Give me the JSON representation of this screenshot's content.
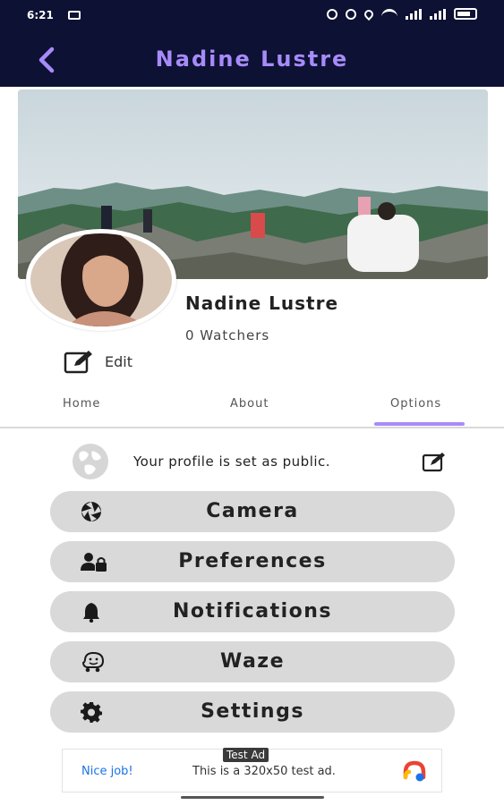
{
  "status_bar": {
    "time": "6:21"
  },
  "header": {
    "title": "Nadine Lustre"
  },
  "profile": {
    "name": "Nadine Lustre",
    "watchers": "0 Watchers",
    "edit_label": "Edit"
  },
  "tabs": [
    {
      "label": "Home"
    },
    {
      "label": "About"
    },
    {
      "label": "Options"
    }
  ],
  "public_status": {
    "text": "Your profile is set as public."
  },
  "menu": [
    {
      "label": "Camera",
      "icon": "camera-aperture-icon"
    },
    {
      "label": "Preferences",
      "icon": "user-lock-icon"
    },
    {
      "label": "Notifications",
      "icon": "bell-icon"
    },
    {
      "label": "Waze",
      "icon": "waze-icon"
    },
    {
      "label": "Settings",
      "icon": "gear-icon"
    }
  ],
  "ad": {
    "tag": "Test Ad",
    "nice": "Nice job!",
    "text": "This is a 320x50 test ad."
  },
  "colors": {
    "header_bg": "#0d1133",
    "accent": "#a78bfa",
    "menu_bg": "#d9d9d9"
  }
}
